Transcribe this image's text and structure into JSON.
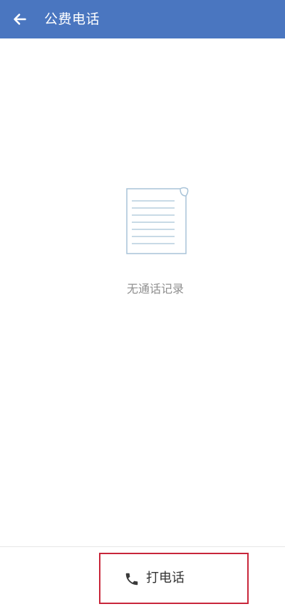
{
  "header": {
    "back_icon": "arrow-left-icon",
    "title": "公费电话",
    "background_color": "#4a76c0"
  },
  "empty_state": {
    "icon": "document-icon",
    "message": "无通话记录"
  },
  "bottom_bar": {
    "call_button_icon": "phone-icon",
    "call_button_label": "打电话",
    "highlight_border_color": "#c8263a"
  }
}
